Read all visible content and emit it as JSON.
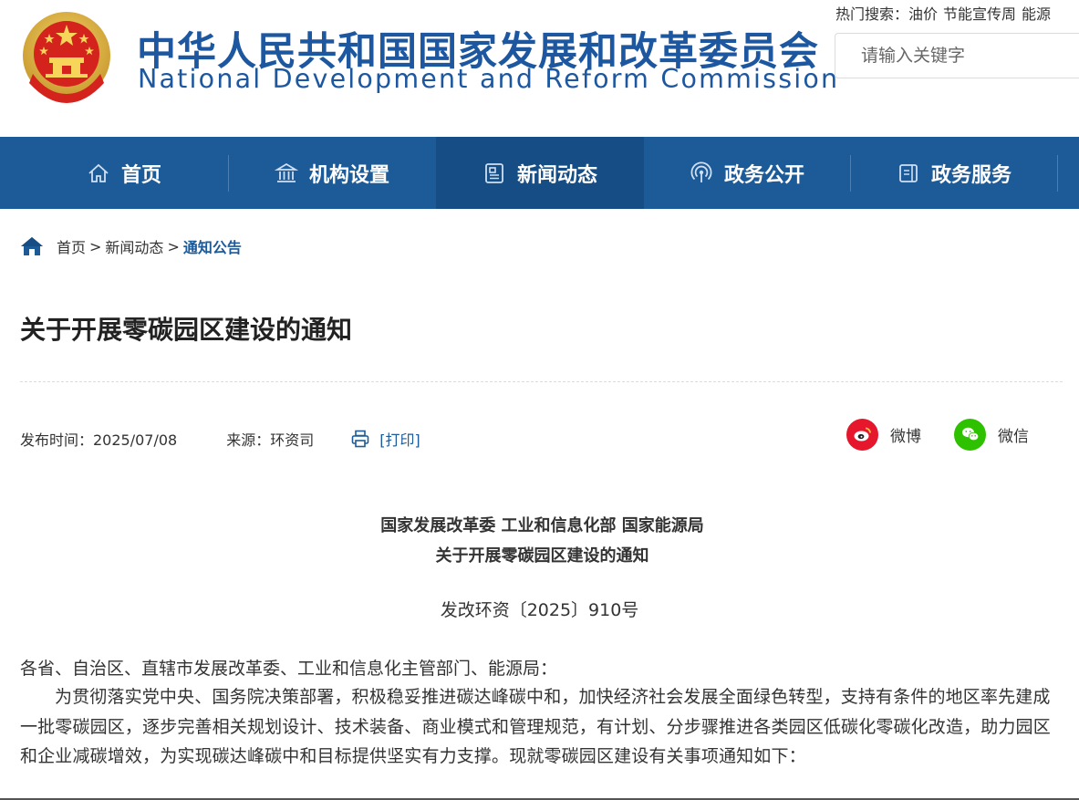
{
  "header": {
    "title_cn": "中华人民共和国国家发展和改革委员会",
    "title_en": "National Development and Reform Commission",
    "hot_search": {
      "label": "热门搜索：",
      "terms": [
        "油价",
        "节能宣传周",
        "能源"
      ]
    },
    "search": {
      "placeholder": "请输入关键字"
    },
    "emblem_icon": "national-emblem-icon"
  },
  "nav": {
    "items": [
      {
        "label": "首页",
        "icon": "home-icon"
      },
      {
        "label": "机构设置",
        "icon": "institution-icon"
      },
      {
        "label": "新闻动态",
        "icon": "news-icon",
        "active": true
      },
      {
        "label": "政务公开",
        "icon": "broadcast-icon"
      },
      {
        "label": "政务服务",
        "icon": "service-icon"
      }
    ]
  },
  "breadcrumb": {
    "items": [
      "首页",
      "新闻动态"
    ],
    "separator": ">",
    "current": "通知公告"
  },
  "article": {
    "title": "关于开展零碳园区建设的通知",
    "publish_time": "发布时间：2025/07/08",
    "source": "来源：环资司",
    "print_label": "[打印]",
    "share": {
      "weibo": "微博",
      "wechat": "微信"
    },
    "doc_heading_line1": "国家发展改革委 工业和信息化部 国家能源局",
    "doc_heading_line2": "关于开展零碳园区建设的通知",
    "doc_number": "发改环资〔2025〕910号",
    "salutation": "各省、自治区、直辖市发展改革委、工业和信息化主管部门、能源局：",
    "body": "为贯彻落实党中央、国务院决策部署，积极稳妥推进碳达峰碳中和，加快经济社会发展全面绿色转型，支持有条件的地区率先建成一批零碳园区，逐步完善相关规划设计、技术装备、商业模式和管理规范，有计划、分步骤推进各类园区低碳化零碳化改造，助力园区和企业减碳增效，为实现碳达峰碳中和目标提供坚实有力支撑。现就零碳园区建设有关事项通知如下："
  },
  "colors": {
    "brand_blue": "#1c57a0",
    "nav_bg": "#1c5a98",
    "nav_active_bg": "#164d84",
    "weibo_red": "#e6162d",
    "wechat_green": "#2dc100"
  }
}
